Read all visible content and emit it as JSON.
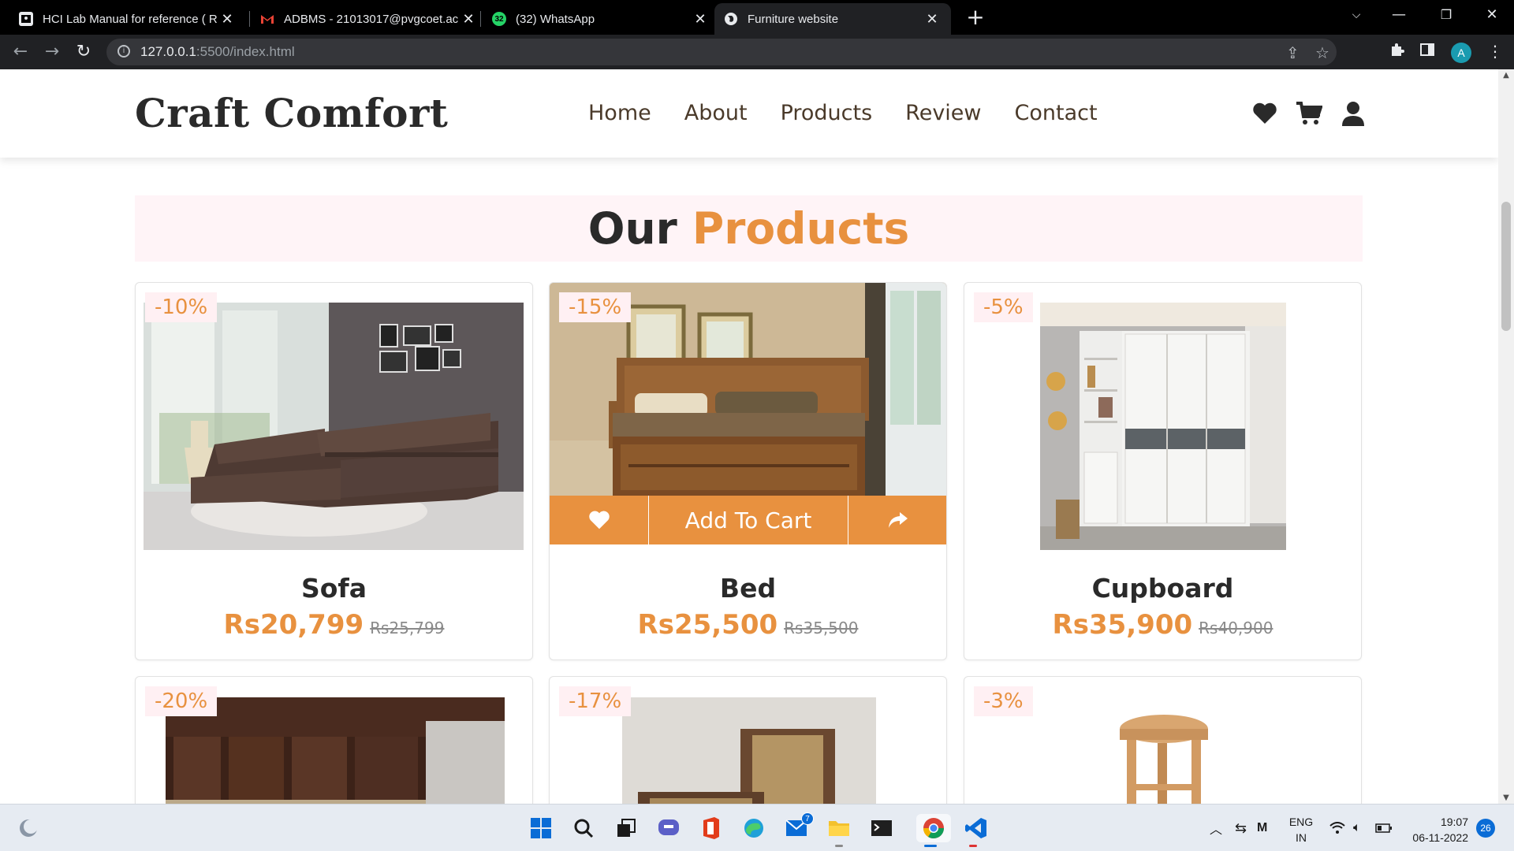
{
  "browser": {
    "tabs": [
      {
        "title": "HCI Lab Manual for reference ( R",
        "active": false
      },
      {
        "title": "ADBMS - 21013017@pvgcoet.ac",
        "active": false
      },
      {
        "title": "(32) WhatsApp",
        "active": false
      },
      {
        "title": "Furniture website",
        "active": true
      }
    ],
    "whatsapp_count": "32",
    "url_host": "127.0.0.1",
    "url_rest": ":5500/index.html",
    "profile_initial": "A"
  },
  "site": {
    "logo": "Craft Comfort",
    "nav": [
      "Home",
      "About",
      "Products",
      "Review",
      "Contact"
    ],
    "icons": [
      "heart-icon",
      "cart-icon",
      "user-icon"
    ]
  },
  "section": {
    "title_plain": "Our",
    "title_accent": "Products"
  },
  "products": [
    {
      "name": "Sofa",
      "discount": "-10%",
      "price": "Rs20,799",
      "old_price": "Rs25,799"
    },
    {
      "name": "Bed",
      "discount": "-15%",
      "price": "Rs25,500",
      "old_price": "Rs35,500"
    },
    {
      "name": "Cupboard",
      "discount": "-5%",
      "price": "Rs35,900",
      "old_price": "Rs40,900"
    },
    {
      "name": "",
      "discount": "-20%"
    },
    {
      "name": "",
      "discount": "-17%"
    },
    {
      "name": "",
      "discount": "-3%"
    }
  ],
  "hover_bar": {
    "add_label": "Add To Cart"
  },
  "taskbar": {
    "mail_badge": "7",
    "lang_top": "ENG",
    "lang_bottom": "IN",
    "time": "19:07",
    "date": "06-11-2022",
    "notifications": "26"
  },
  "colors": {
    "accent": "#e8913f",
    "title_bg": "#fff4f7",
    "browser_dark": "#202124"
  }
}
